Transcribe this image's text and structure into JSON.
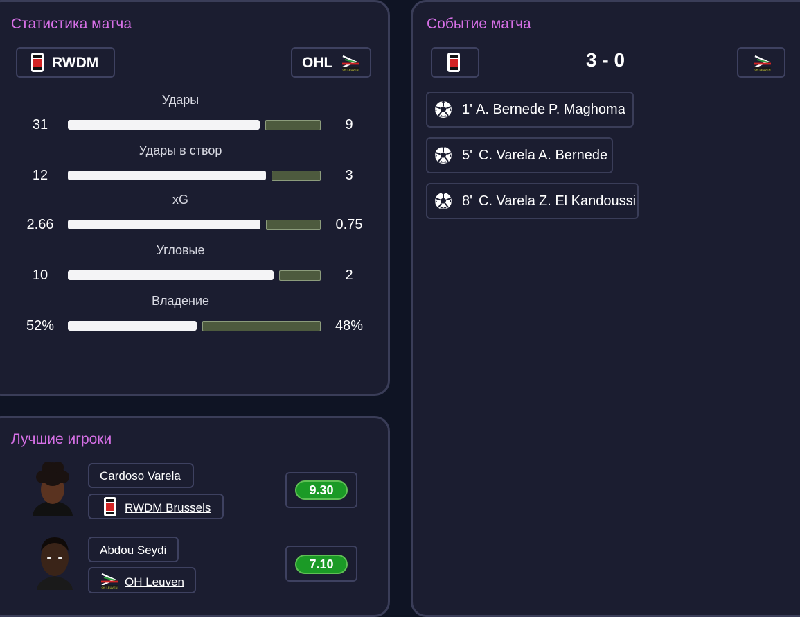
{
  "stats": {
    "title": "Статистика матча",
    "home_team": "RWDM",
    "away_team": "OHL",
    "rows": [
      {
        "label": "Удары",
        "home": "31",
        "away": "9",
        "home_share": 0.775
      },
      {
        "label": "Удары в створ",
        "home": "12",
        "away": "3",
        "home_share": 0.8
      },
      {
        "label": "xG",
        "home": "2.66",
        "away": "0.75",
        "home_share": 0.78
      },
      {
        "label": "Угловые",
        "home": "10",
        "away": "2",
        "home_share": 0.833
      },
      {
        "label": "Владение",
        "home": "52%",
        "away": "48%",
        "home_share": 0.52
      }
    ]
  },
  "events": {
    "title": "Событие матча",
    "score": "3 - 0",
    "goals": [
      {
        "minute": "1'",
        "scorer": "A. Bernede",
        "assist": "P. Maghoma"
      },
      {
        "minute": "5'",
        "scorer": "C. Varela",
        "assist": "A. Bernede"
      },
      {
        "minute": "8'",
        "scorer": "C. Varela",
        "assist": "Z. El Kandoussi"
      }
    ]
  },
  "players": {
    "title": "Лучшие игроки",
    "items": [
      {
        "name": "Cardoso Varela",
        "team": "RWDM Brussels",
        "rating": "9.30"
      },
      {
        "name": "Abdou Seydi",
        "team": "OH Leuven",
        "rating": "7.10"
      }
    ]
  },
  "icons": {
    "home_crest": "rwdm-crest-icon",
    "away_crest": "oh-leuven-crest-icon",
    "goal": "soccer-ball-icon"
  },
  "colors": {
    "accent": "#d670e6",
    "rating_green": "#1b9a26",
    "away_bar": "#4d5a3e"
  }
}
